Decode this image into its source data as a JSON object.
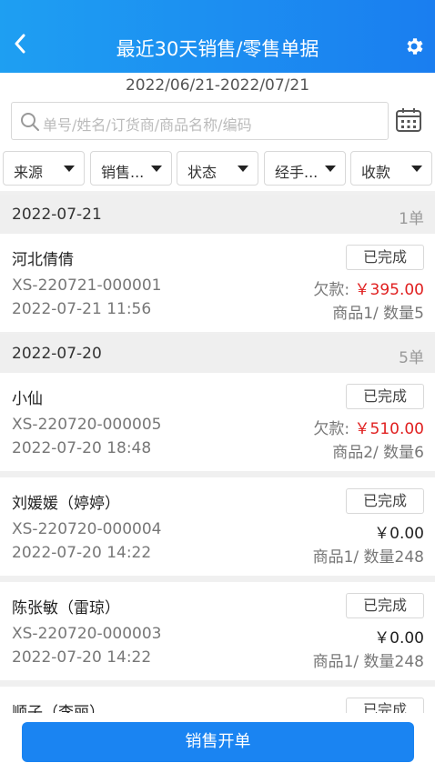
{
  "header": {
    "title": "最近30天销售/零售单据"
  },
  "date_range": "2022/06/21-2022/07/21",
  "search": {
    "placeholder": "单号/姓名/订货商/商品名称/编码"
  },
  "filters": [
    {
      "label": "来源"
    },
    {
      "label": "销售..."
    },
    {
      "label": "状态"
    },
    {
      "label": "经手..."
    },
    {
      "label": "收款"
    }
  ],
  "groups": [
    {
      "date": "2022-07-21",
      "count": "1单"
    },
    {
      "date": "2022-07-20",
      "count": "5单"
    }
  ],
  "orders": [
    {
      "name": "河北倩倩",
      "status": "已完成",
      "code": "XS-220721-000001",
      "time": "2022-07-21 11:56",
      "debt_label": "欠款:",
      "amount": "￥395.00",
      "qty": "商品1/ 数量5"
    },
    {
      "name": "小仙",
      "status": "已完成",
      "code": "XS-220720-000005",
      "time": "2022-07-20 18:48",
      "debt_label": "欠款:",
      "amount": "￥510.00",
      "qty": "商品2/ 数量6"
    },
    {
      "name": "刘媛媛（婷婷）",
      "status": "已完成",
      "code": "XS-220720-000004",
      "time": "2022-07-20 14:22",
      "amount": "￥0.00",
      "qty": "商品1/ 数量248"
    },
    {
      "name": "陈张敏（雷琼）",
      "status": "已完成",
      "code": "XS-220720-000003",
      "time": "2022-07-20 14:22",
      "amount": "￥0.00",
      "qty": "商品1/ 数量248"
    },
    {
      "name": "顺子（李丽）",
      "status": "已完成"
    }
  ],
  "bottom": {
    "button_label": "销售开单"
  },
  "colors": {
    "header_bg": "#1a84f2",
    "debt_red": "#e02020",
    "primary_button": "#1a84f2"
  },
  "icons": [
    "back-chevron-icon",
    "gear-icon",
    "search-icon",
    "calendar-icon",
    "dropdown-triangle-icon"
  ]
}
